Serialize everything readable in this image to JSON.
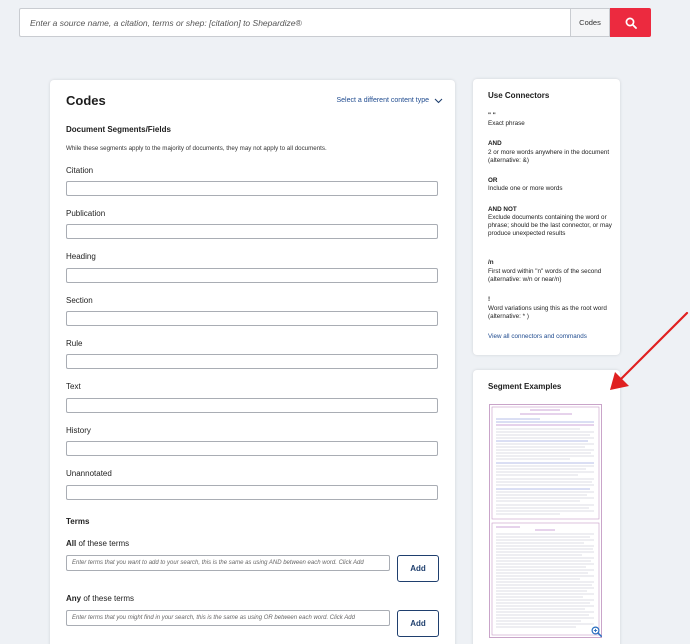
{
  "search": {
    "placeholder": "Enter a source name, a citation, terms or shep: [citation] to Shepardize®",
    "scope": "Codes",
    "button_icon": "search-icon"
  },
  "main": {
    "title": "Codes",
    "content_type_link": "Select a different content type",
    "segments_title": "Document Segments/Fields",
    "intro": "While these segments apply to the majority of documents, they may not apply to all documents.",
    "fields": [
      "Citation",
      "Publication",
      "Heading",
      "Section",
      "Rule",
      "Text",
      "History",
      "Unannotated"
    ],
    "terms_title": "Terms",
    "all_terms": {
      "bold": "All",
      "rest": " of these terms",
      "placeholder": "Enter terms that you want to add to your search, this is the same as using AND between each word. Click Add",
      "button": "Add"
    },
    "any_terms": {
      "bold": "Any",
      "rest": " of these terms",
      "placeholder": "Enter terms that you might find in your search, this is the same as using OR between each word. Click Add",
      "button": "Add"
    }
  },
  "connectors": {
    "title": "Use Connectors",
    "items": [
      {
        "name": "\" \"",
        "desc": "Exact phrase"
      },
      {
        "name": "AND",
        "desc": "2 or more words anywhere in the document (alternative: &)"
      },
      {
        "name": "OR",
        "desc": "Include one or more words"
      },
      {
        "name": "AND NOT",
        "desc": "Exclude documents containing the word or phrase; should be the last connector, or may produce unexpected results"
      },
      {
        "name": "/n",
        "desc": "First word within \"n\" words of the second (alternative: w/n or near/n)"
      },
      {
        "name": "!",
        "desc": "Word variations using this as the root word (alternative: * )"
      }
    ],
    "link": "View all connectors and commands"
  },
  "segments": {
    "title": "Segment Examples",
    "zoom_icon": "zoom-in-icon"
  },
  "colors": {
    "accent": "#ec2a3f",
    "link": "#1f4b8f",
    "annotation_arrow": "#e02020",
    "thumb_border": "#c9a4c9"
  }
}
